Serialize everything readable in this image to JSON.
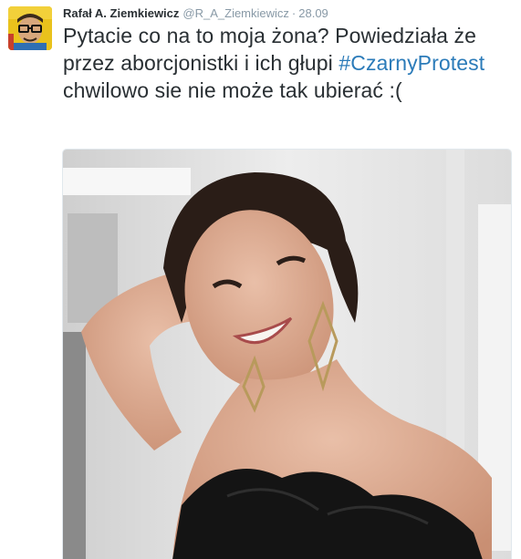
{
  "tweet": {
    "author_name": "Rafał A. Ziemkiewicz",
    "handle": "@R_A_Ziemkiewicz",
    "separator": "·",
    "date": "28.09",
    "text_part1": "Pytacie co na to moja żona? Powiedziała że przez aborcjonistki i ich głupi ",
    "hashtag": "#CzarnyProtest",
    "text_part2": " chwilowo sie nie może tak ubierać  :("
  },
  "colors": {
    "text": "#292f33",
    "muted": "#8899a6",
    "link": "#2b7bb9"
  },
  "icons": {
    "avatar": "cartoon-portrait",
    "photo": "woman-portrait-photo"
  }
}
